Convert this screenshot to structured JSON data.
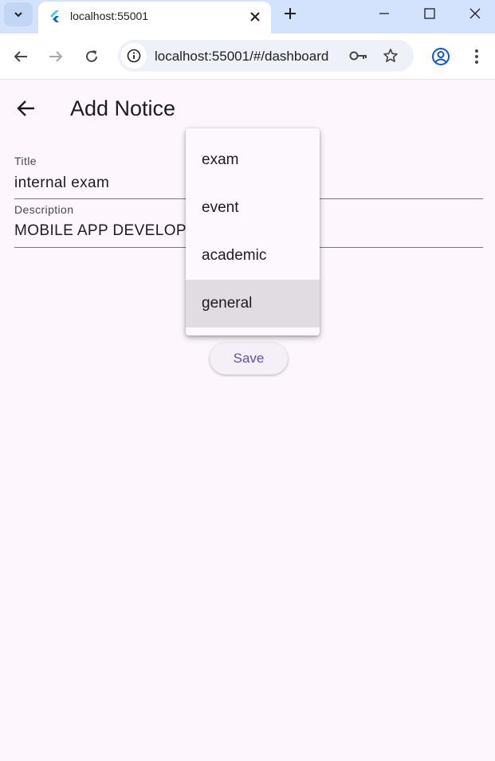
{
  "browser": {
    "tab_title": "localhost:55001",
    "url": "localhost:55001/#/dashboard"
  },
  "app": {
    "title": "Add Notice",
    "fields": {
      "title": {
        "label": "Title",
        "value": "internal exam"
      },
      "description": {
        "label": "Description",
        "value": "MOBILE APP DEVELOP"
      }
    },
    "category_menu": {
      "options": [
        "exam",
        "event",
        "academic",
        "general"
      ],
      "selected": "general"
    },
    "save_label": "Save"
  },
  "colors": {
    "app_background": "#fdf6fd",
    "accent": "#6750a4",
    "tabstrip": "#d3e3fd"
  }
}
